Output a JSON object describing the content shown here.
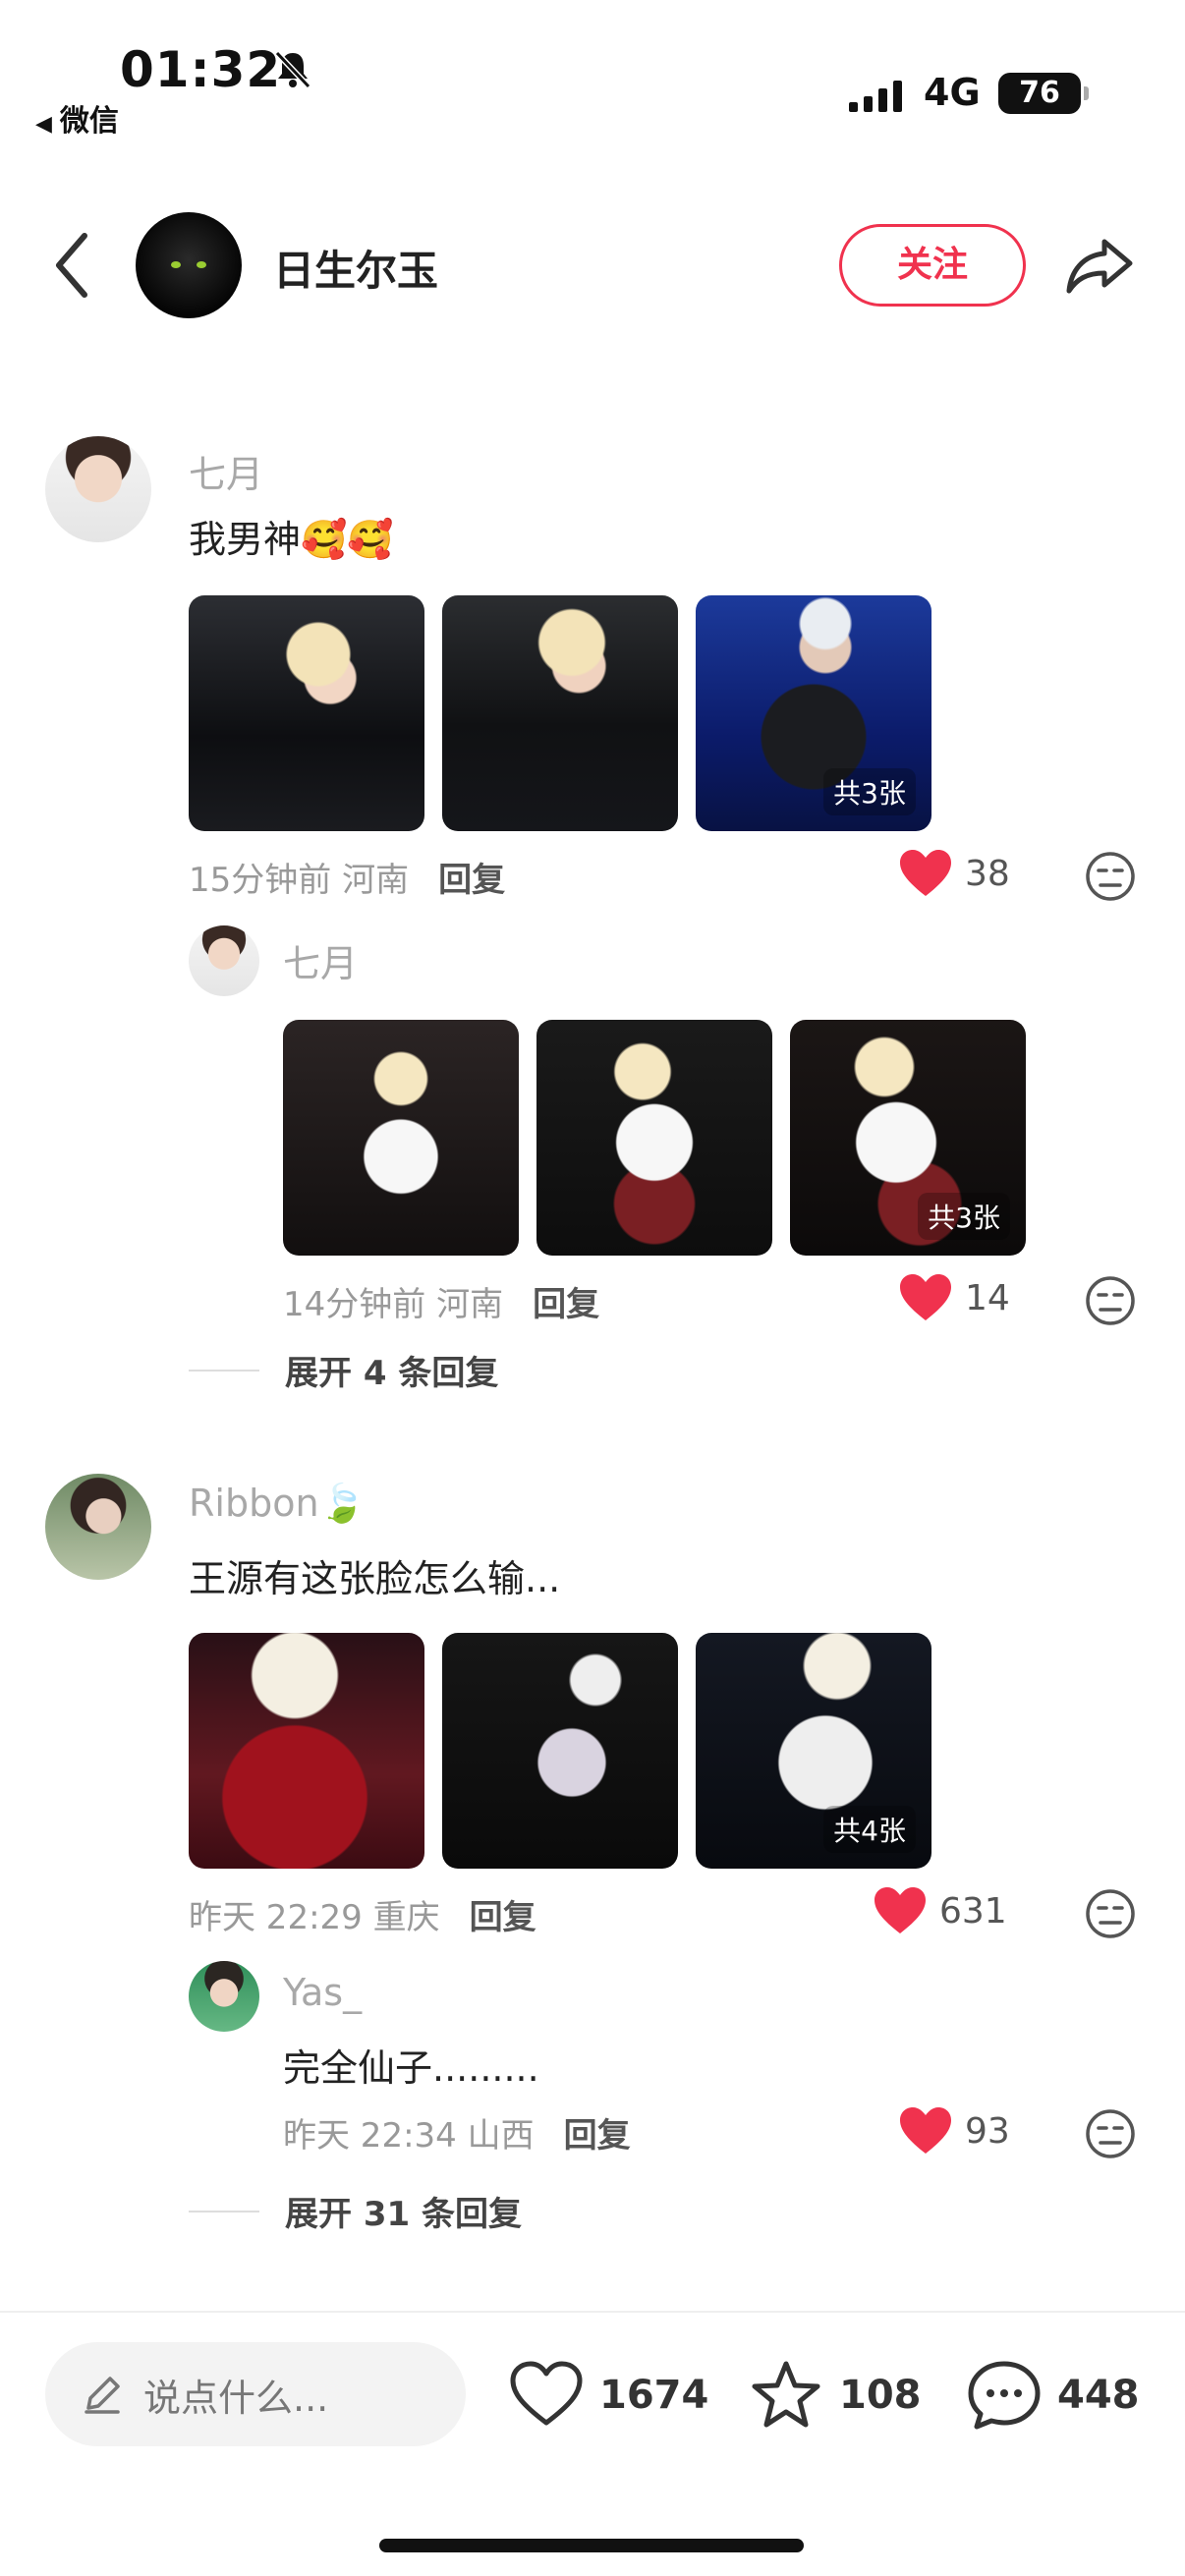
{
  "status_bar": {
    "time": "01:32",
    "back_app": "微信",
    "network": "4G",
    "battery": "76"
  },
  "header": {
    "name": "日生尔玉",
    "follow_label": "关注"
  },
  "comments": [
    {
      "user": "七月",
      "text": "我男神🥰🥰",
      "photo_count": "共3张",
      "time": "15分钟前 河南",
      "reply_label": "回复",
      "likes": "38",
      "replies": [
        {
          "user": "七月",
          "photo_count": "共3张",
          "time": "14分钟前 河南",
          "reply_label": "回复",
          "likes": "14"
        }
      ],
      "expand": "展开 4 条回复"
    },
    {
      "user": "Ribbon🍃",
      "text": "王源有这张脸怎么输...",
      "photo_count": "共4张",
      "time": "昨天 22:29 重庆",
      "reply_label": "回复",
      "likes": "631",
      "replies": [
        {
          "user": "Yas_",
          "text": "完全仙子.........",
          "time": "昨天 22:34 山西",
          "reply_label": "回复",
          "likes": "93"
        }
      ],
      "expand": "展开 31 条回复"
    }
  ],
  "bottom_bar": {
    "input_placeholder": "说点什么...",
    "likes": "1674",
    "stars": "108",
    "comments": "448"
  },
  "colors": {
    "accent": "#f0324e",
    "heart": "#f0324e"
  },
  "icons": [
    "bell-off-icon",
    "signal-icon",
    "back-chevron-icon",
    "share-icon",
    "heart-icon",
    "dislike-face-icon",
    "pencil-icon",
    "star-icon",
    "comment-bubble-icon"
  ]
}
